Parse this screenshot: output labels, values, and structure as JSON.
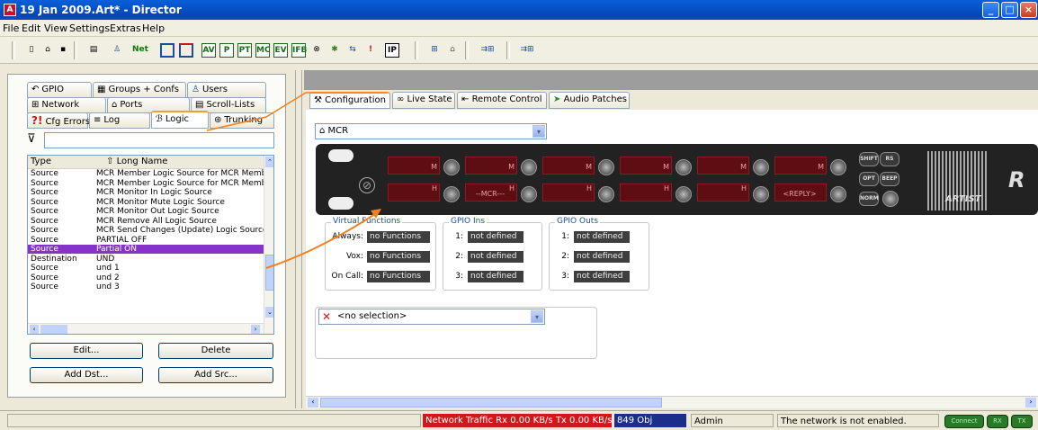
{
  "window": {
    "title": "19 Jan 2009.Art* - Director",
    "icon_letter": "A"
  },
  "menu": [
    "File",
    "Edit",
    "View",
    "Settings",
    "Extras",
    "Help"
  ],
  "toolbar": {
    "net_label": "Net",
    "icons": [
      "new-icon",
      "open-icon",
      "save-icon",
      "print-icon",
      "user-icon",
      "net-icon",
      "window-icon",
      "window2-icon",
      "av-icon",
      "p-icon",
      "pt-icon",
      "mc-icon",
      "ev-icon",
      "ifb-icon",
      "sync-icon",
      "tool-icon",
      "arrows-icon",
      "alert-icon",
      "ip-icon",
      "b1-icon",
      "b2-icon",
      "b3-icon",
      "b4-icon"
    ]
  },
  "left_tabs": {
    "row1": [
      "GPIO",
      "Groups + Confs",
      "Users"
    ],
    "row2": [
      "Network",
      "Ports",
      "Scroll-Lists"
    ],
    "row3": [
      "Cfg Errors",
      "Log",
      "Logic",
      "Trunking"
    ]
  },
  "table": {
    "headers": [
      "Type",
      "Long Name"
    ],
    "rows": [
      [
        "Source",
        "MCR Member Logic Source for MCR Membe"
      ],
      [
        "Source",
        "MCR Member Logic Source for MCR Membe"
      ],
      [
        "Source",
        "MCR Monitor In Logic Source"
      ],
      [
        "Source",
        "MCR Monitor Mute Logic Source"
      ],
      [
        "Source",
        "MCR Monitor Out Logic Source"
      ],
      [
        "Source",
        "MCR Remove All Logic Source"
      ],
      [
        "Source",
        "MCR Send Changes (Update) Logic Source"
      ],
      [
        "Source",
        "PARTIAL OFF"
      ],
      [
        "Source",
        "Partial ON"
      ],
      [
        "Destination",
        "UND"
      ],
      [
        "Source",
        "und 1"
      ],
      [
        "Source",
        "und 2"
      ],
      [
        "Source",
        "und 3"
      ]
    ],
    "selected_index": 8
  },
  "buttons": {
    "edit": "Edit...",
    "delete": "Delete",
    "add_dst": "Add Dst...",
    "add_src": "Add Src..."
  },
  "right_tabs": [
    "Configuration",
    "Live State",
    "Remote Control",
    "Audio Patches"
  ],
  "panel_select": "MCR",
  "panel": {
    "display_marks": [
      "M",
      "M",
      "M",
      "M",
      "M",
      "M"
    ],
    "bottom_displays": [
      "",
      "--MCR---",
      "",
      "",
      "",
      "<REPLY>"
    ],
    "bottom_marks": [
      "H",
      "H",
      "H",
      "H",
      "H",
      ""
    ],
    "side_buttons": [
      "SHIFT",
      "RS",
      "OPT",
      "BEEP",
      "NORM"
    ],
    "brand": "ARTIST",
    "brand_letter": "R"
  },
  "virtual_functions": {
    "title": "Virtual Functions",
    "rows": [
      [
        "Always:",
        "no Functions"
      ],
      [
        "Vox:",
        "no Functions"
      ],
      [
        "On Call:",
        "no Functions"
      ]
    ]
  },
  "gpio_ins": {
    "title": "GPIO Ins",
    "rows": [
      [
        "1:",
        "not defined"
      ],
      [
        "2:",
        "not defined"
      ],
      [
        "3:",
        "not defined"
      ]
    ]
  },
  "gpio_outs": {
    "title": "GPIO Outs",
    "rows": [
      [
        "1:",
        "not defined"
      ],
      [
        "2:",
        "not defined"
      ],
      [
        "3:",
        "not defined"
      ]
    ]
  },
  "no_selection": "<no selection>",
  "status": {
    "traffic": "Network Traffic Rx 0.00 KB/s  Tx 0.00 KB/s",
    "objects": "849 Obj",
    "user": "Admin",
    "network_msg": "The network is not enabled.",
    "leds": [
      "Connect",
      "RX",
      "TX"
    ]
  },
  "colors": {
    "selection": "#8732c8",
    "traffic_bg": "#cc1a1a",
    "obj_bg": "#1a2f8a",
    "arrow": "#f08020"
  }
}
